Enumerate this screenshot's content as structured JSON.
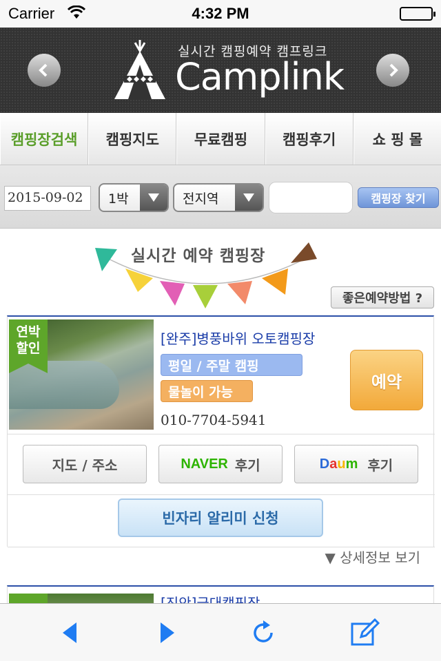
{
  "status": {
    "carrier": "Carrier",
    "time": "4:32 PM",
    "battery_level": 1.0
  },
  "header": {
    "tagline": "실시간 캠핑예약 캠프링크",
    "brand": "Camplink"
  },
  "nav": [
    {
      "label": "캠핑장검색",
      "active": true
    },
    {
      "label": "캠핑지도",
      "active": false
    },
    {
      "label": "무료캠핑",
      "active": false
    },
    {
      "label": "캠핑후기",
      "active": false
    },
    {
      "label": "쇼 핑 몰",
      "active": false
    }
  ],
  "search": {
    "date": "2015-09-02",
    "nights": "1박",
    "region": "전지역",
    "keyword": "",
    "button": "캠핑장 찾기"
  },
  "banner": {
    "title": "실시간 예약 캠핑장",
    "tip_button": "좋은예약방법 ?"
  },
  "listings": [
    {
      "ribbon": "연박 할인",
      "name": "[완주]병풍바위 오토캠핑장",
      "tag1": "평일 / 주말 캠핑",
      "tag2": "물놀이 가능",
      "phone": "010-7704-5941",
      "reserve": "예약",
      "map_button": "지도 / 주소",
      "naver_logo": "NAVER",
      "naver_label": "후기",
      "daum_logo": "Daum",
      "daum_label": "후기",
      "alert_button": "빈자리 알리미 신청"
    },
    {
      "name": "[진안]금대캠핑장"
    }
  ],
  "more_link": "▼ 상세정보 보기",
  "colors": {
    "accent_green": "#5a9e2a",
    "link_blue": "#1a3ca8",
    "header_bg": "#333333"
  }
}
